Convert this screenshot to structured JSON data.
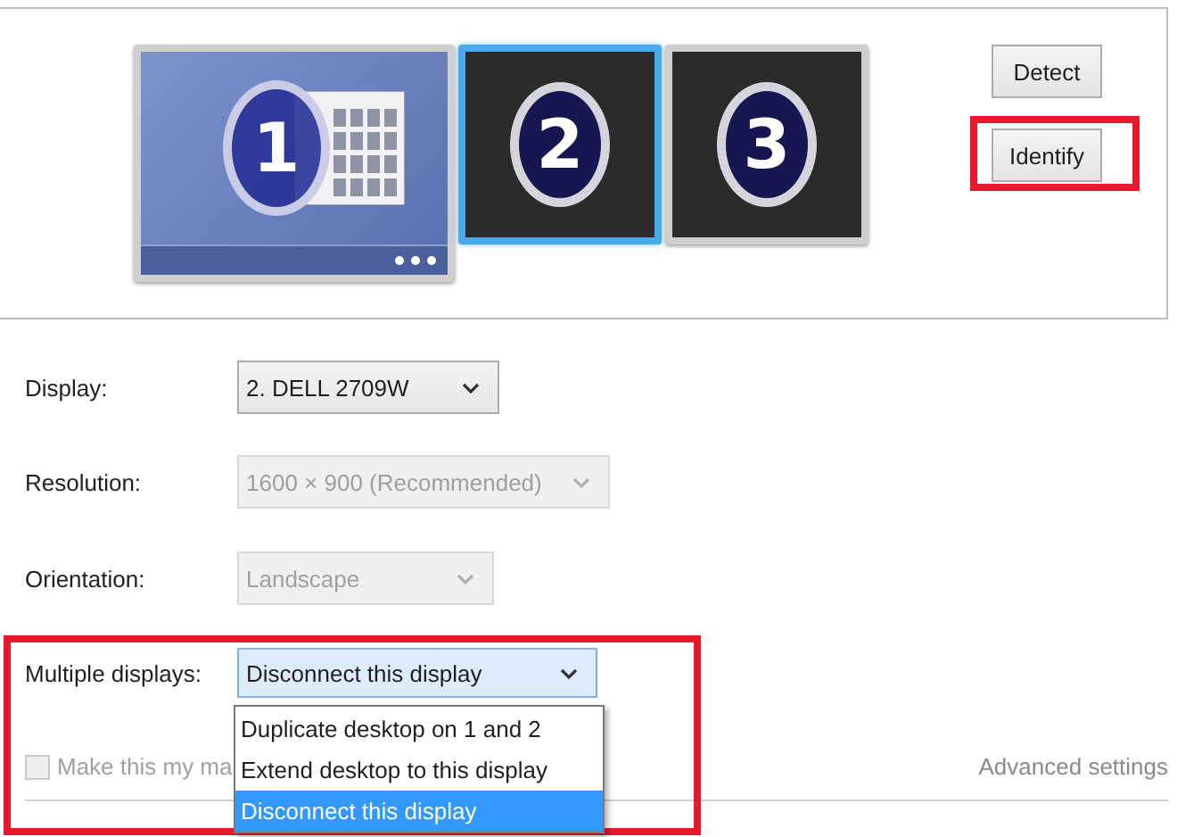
{
  "monitors": [
    {
      "number": "1",
      "primary": true,
      "selected": false
    },
    {
      "number": "2",
      "primary": false,
      "selected": true
    },
    {
      "number": "3",
      "primary": false,
      "selected": false
    }
  ],
  "buttons": [
    {
      "label": "Detect",
      "highlighted": false
    },
    {
      "label": "Identify",
      "highlighted": true
    }
  ],
  "settings": [
    {
      "label": "Display:",
      "value": "2. DELL 2709W",
      "disabled": false,
      "open": false,
      "highlighted": false
    },
    {
      "label": "Resolution:",
      "value": "1600 × 900 (Recommended)",
      "disabled": true,
      "open": false,
      "highlighted": false
    },
    {
      "label": "Orientation:",
      "value": "Landscape",
      "disabled": true,
      "open": false,
      "highlighted": false
    },
    {
      "label": "Multiple displays:",
      "value": "Disconnect this display",
      "disabled": false,
      "open": true,
      "highlighted": true,
      "options": [
        {
          "label": "Duplicate desktop on 1 and 2",
          "selected": false
        },
        {
          "label": "Extend desktop to this display",
          "selected": false
        },
        {
          "label": "Disconnect this display",
          "selected": true
        }
      ]
    }
  ],
  "main_display_checkbox": {
    "label": "Make this my ma",
    "checked": false,
    "disabled": true
  },
  "advanced_link": "Advanced settings"
}
